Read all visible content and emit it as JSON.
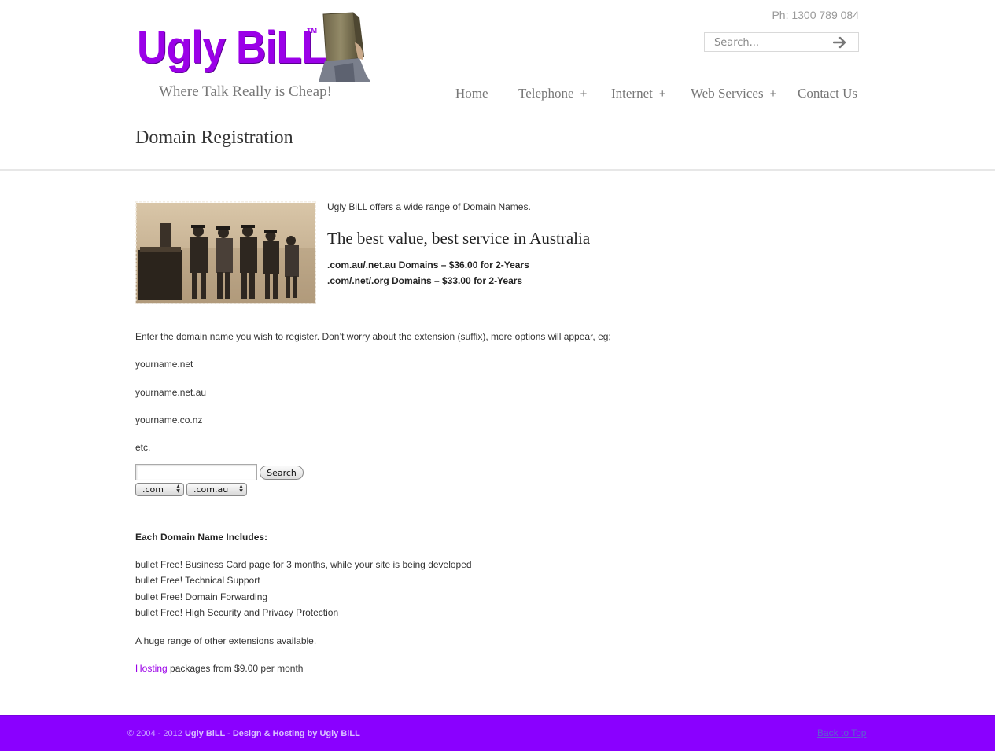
{
  "header": {
    "logo_text": "Ugly BiLL",
    "logo_tm": "TM",
    "tagline": "Where Talk Really is Cheap!",
    "phone": "Ph: 1300 789 084",
    "search_placeholder": "Search..."
  },
  "nav": {
    "items": [
      {
        "label": "Home",
        "has_sub": false
      },
      {
        "label": "Telephone",
        "has_sub": true
      },
      {
        "label": "Internet",
        "has_sub": true
      },
      {
        "label": "Web Services",
        "has_sub": true
      },
      {
        "label": "Contact Us",
        "has_sub": false
      }
    ],
    "plus": "+"
  },
  "page": {
    "title": "Domain Registration",
    "intro": "Ugly BiLL offers a wide range of Domain Names.",
    "heading": "The best value, best service in Australia",
    "prices": [
      ".com.au/.net.au Domains – $36.00 for 2-Years",
      ".com/.net/.org Domains – $33.00 for 2-Years"
    ],
    "instructions": "Enter the domain name you wish to register. Don’t worry about the extension (suffix), more options will appear, eg;",
    "examples": [
      "yourname.net",
      "yourname.net.au",
      "yourname.co.nz",
      "etc."
    ],
    "form": {
      "search_button": "Search",
      "ext1": ".com",
      "ext2": ".com.au"
    },
    "includes_heading": "Each Domain Name Includes:",
    "includes": [
      "bullet Free! Business Card page for 3 months, while your site is being developed",
      "bullet Free! Technical Support",
      "bullet Free! Domain Forwarding",
      "bullet Free! High Security and Privacy Protection"
    ],
    "range_note": "A huge range of other extensions available.",
    "hosting_link": "Hosting",
    "hosting_rest": " packages from $9.00 per month"
  },
  "footer": {
    "copyright_prefix": "© 2004 - 2012 ",
    "copyright_bold": "Ugly BiLL - Design & Hosting by Ugly BiLL",
    "back_to_top": "Back to Top"
  },
  "colors": {
    "brand_purple": "#9b00e8",
    "footer_purple": "#8a00ff"
  }
}
